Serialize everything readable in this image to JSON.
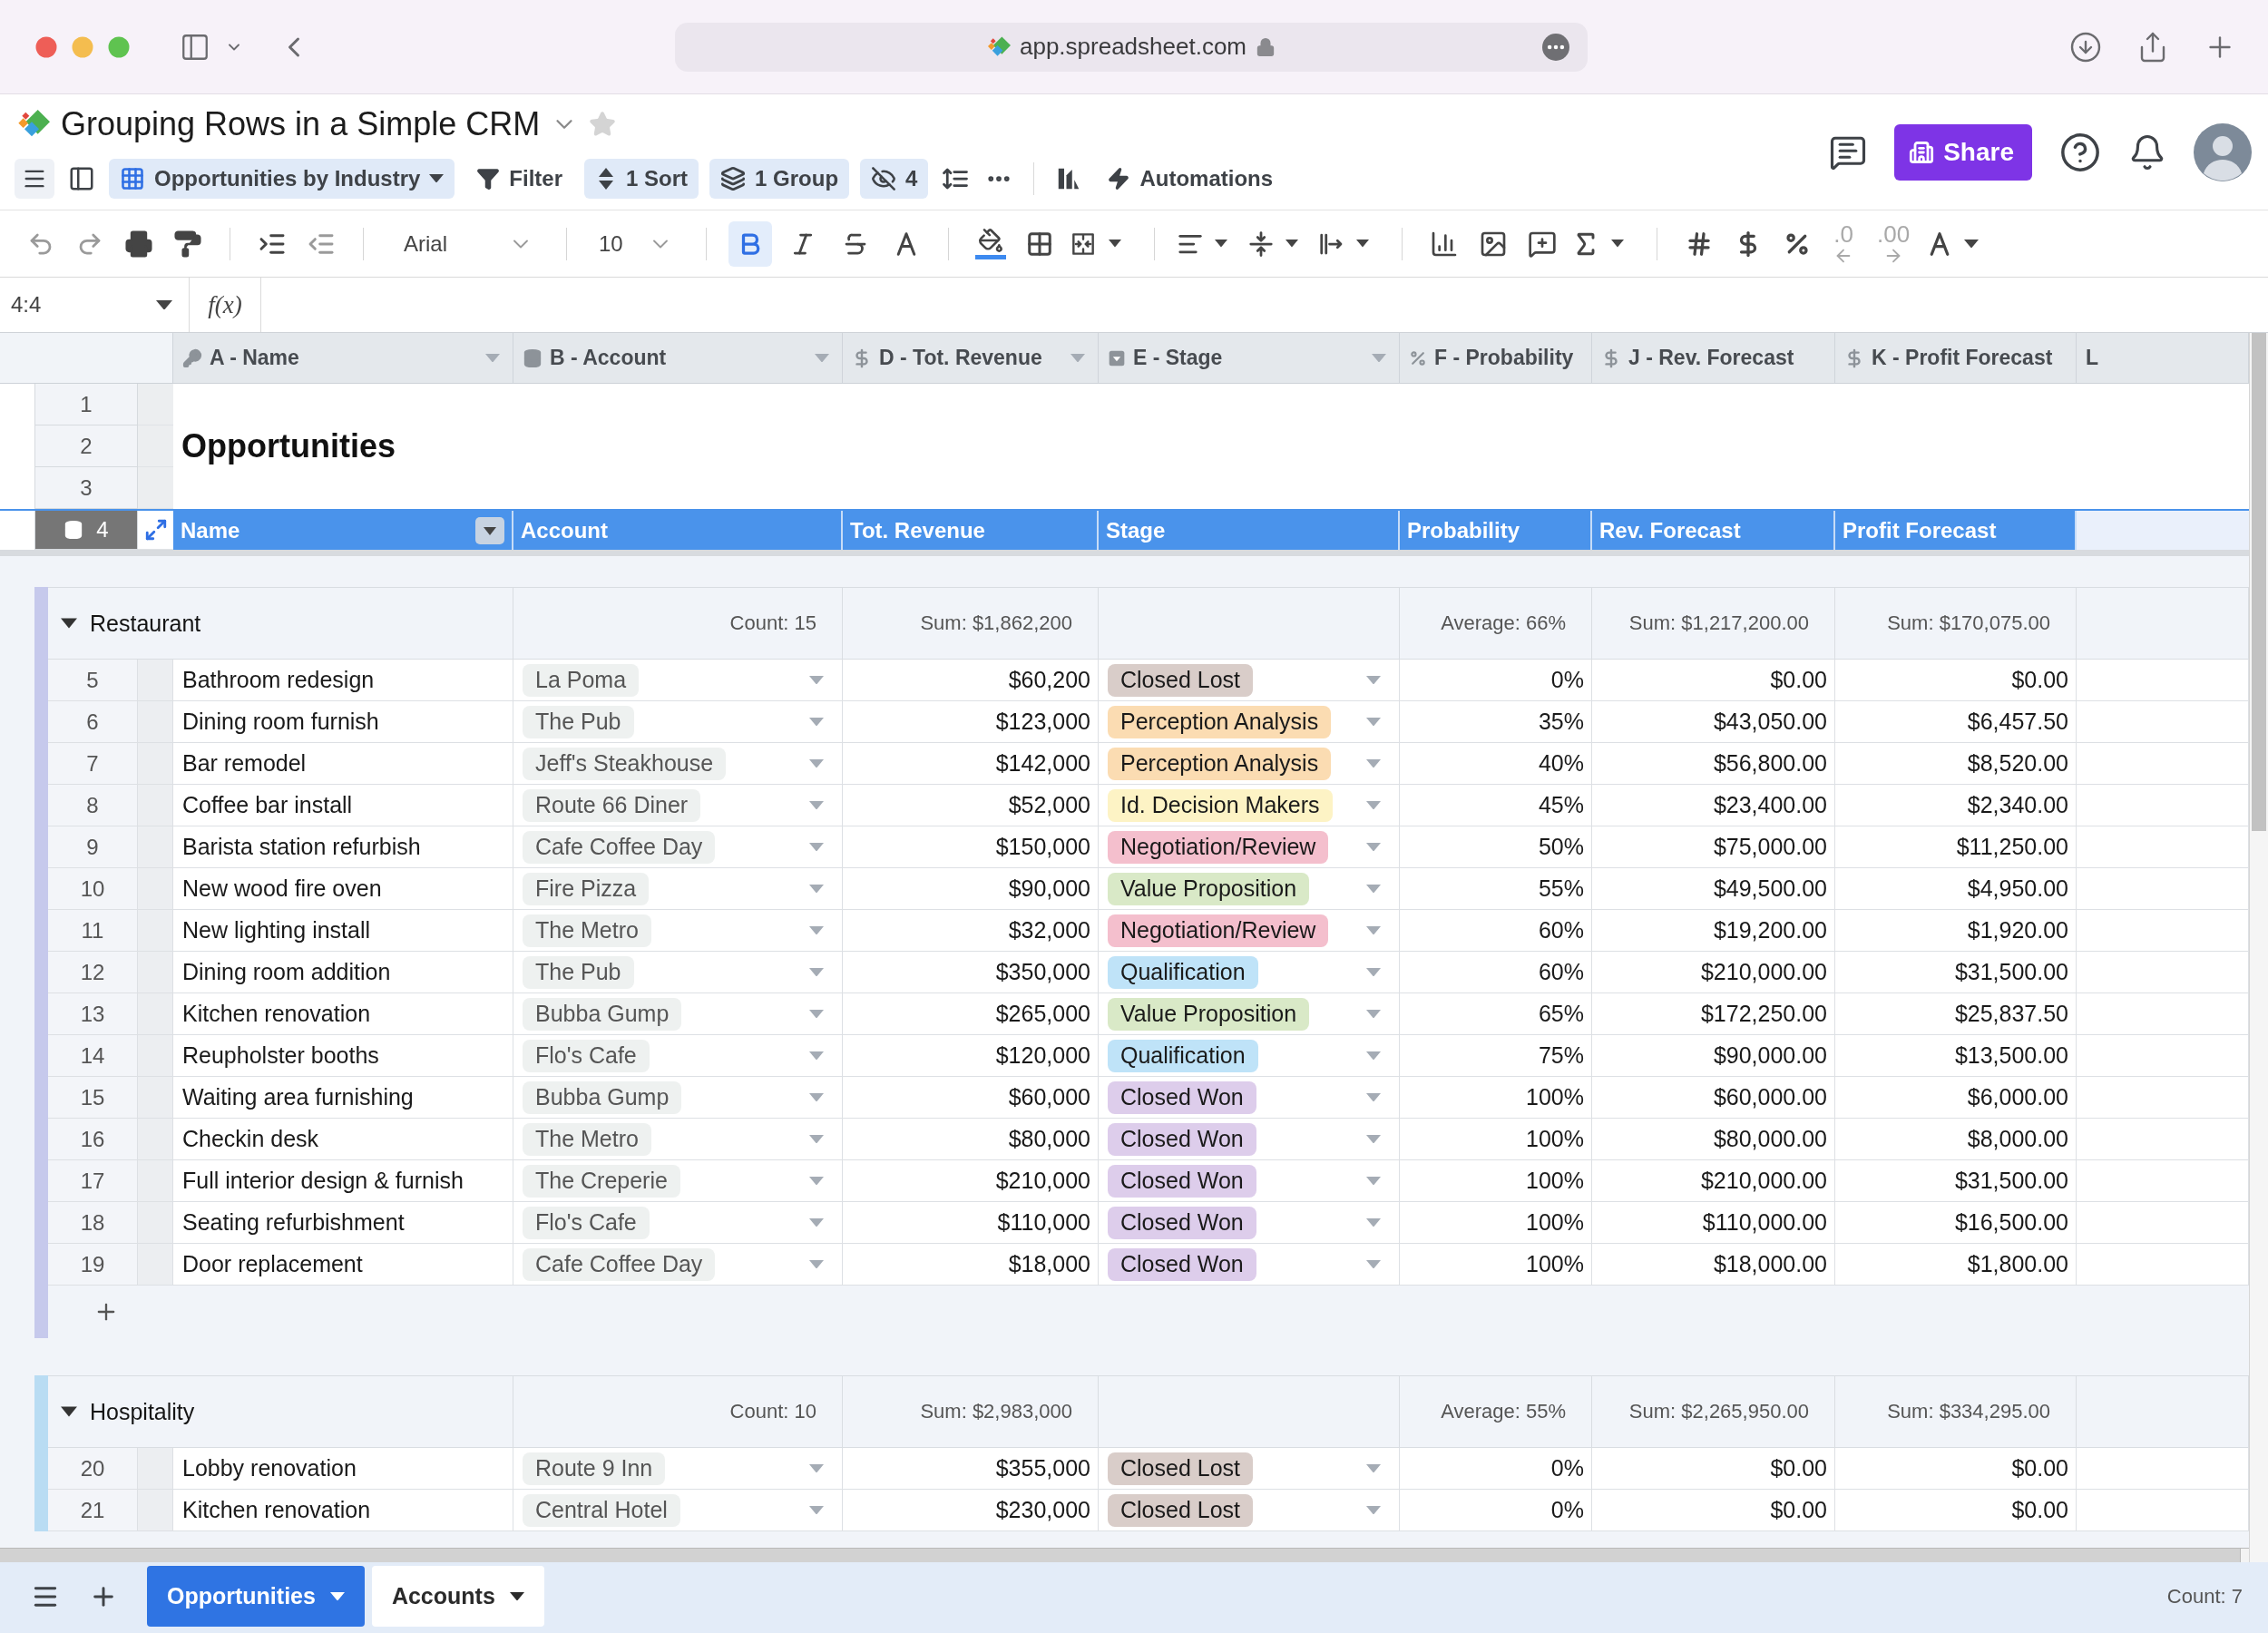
{
  "browser": {
    "url": "app.spreadsheet.com"
  },
  "app_header": {
    "title": "Grouping Rows in a Simple CRM",
    "starred": false,
    "share_label": "Share"
  },
  "view_toolbar": {
    "view": {
      "label": "Opportunities by Industry",
      "active": true
    },
    "tools": [
      {
        "kind": "filter",
        "label": "Filter",
        "active": false
      },
      {
        "kind": "sort",
        "label": "1 Sort",
        "active": true
      },
      {
        "kind": "group",
        "label": "1 Group",
        "active": true
      },
      {
        "kind": "hidden_fields",
        "label": "4",
        "active": true
      }
    ],
    "automations": {
      "label": "Automations"
    }
  },
  "format_toolbar": {
    "history": [
      {
        "kind": "undo",
        "disabled": true
      },
      {
        "kind": "redo",
        "disabled": true
      }
    ],
    "indent": [
      {
        "kind": "increase",
        "disabled": false
      },
      {
        "kind": "decrease",
        "disabled": true
      }
    ],
    "font": "Arial",
    "font_size": "10",
    "text_styles": [
      {
        "kind": "bold",
        "on": true
      },
      {
        "kind": "italic",
        "on": false
      },
      {
        "kind": "strikethrough",
        "on": false
      }
    ],
    "decimals": [
      {
        "kind": "decrease",
        "label": ".0",
        "disabled": true
      },
      {
        "kind": "increase",
        "label": ".00",
        "disabled": true
      }
    ]
  },
  "formula_bar": {
    "cell_ref": "4:4",
    "function_label": "f(x)"
  },
  "columns": [
    {
      "label": "A - Name",
      "kind": "key",
      "has_menu": true
    },
    {
      "label": "B - Account",
      "kind": "lookup",
      "has_menu": true
    },
    {
      "label": "D - Tot. Revenue",
      "kind": "currency",
      "has_menu": true
    },
    {
      "label": "E - Stage",
      "kind": "select",
      "has_menu": true
    },
    {
      "label": "F - Probability",
      "kind": "percent",
      "has_menu": false
    },
    {
      "label": "J - Rev. Forecast",
      "kind": "currency",
      "has_menu": false
    },
    {
      "label": "K - Profit Forecast",
      "kind": "currency",
      "has_menu": false
    },
    {
      "label": "L",
      "kind": "plain",
      "has_menu": false
    }
  ],
  "top_rows": [
    {
      "number": "1",
      "kind": "blank",
      "selected": false
    },
    {
      "number": "2",
      "kind": "title",
      "selected": false,
      "title": "Opportunities"
    },
    {
      "number": "3",
      "kind": "blank",
      "selected": false
    },
    {
      "number": "4",
      "kind": "header",
      "selected": true,
      "cells": [
        "Name",
        "Account",
        "Tot. Revenue",
        "Stage",
        "Probability",
        "Rev. Forecast",
        "Profit Forecast"
      ]
    }
  ],
  "groups": [
    {
      "name": "Restaurant",
      "expanded": true,
      "color": "#c6c9ec",
      "add_row": true,
      "summary": {
        "count": "Count: 15",
        "revenue": "Sum: $1,862,200",
        "probability": "Average: 66%",
        "rev_forecast": "Sum: $1,217,200.00",
        "profit_forecast": "Sum: $170,075.00"
      },
      "rows": [
        {
          "number": "5",
          "name": "Bathroom redesign",
          "account": "La Poma",
          "revenue": "$60,200",
          "stage": {
            "label": "Closed Lost",
            "color": "#d9cdc9"
          },
          "probability": "0%",
          "rev_forecast": "$0.00",
          "profit_forecast": "$0.00"
        },
        {
          "number": "6",
          "name": "Dining room furnish",
          "account": "The Pub",
          "revenue": "$123,000",
          "stage": {
            "label": "Perception Analysis",
            "color": "#fbdcb2"
          },
          "probability": "35%",
          "rev_forecast": "$43,050.00",
          "profit_forecast": "$6,457.50"
        },
        {
          "number": "7",
          "name": "Bar remodel",
          "account": "Jeff's Steakhouse",
          "revenue": "$142,000",
          "stage": {
            "label": "Perception Analysis",
            "color": "#fbdcb2"
          },
          "probability": "40%",
          "rev_forecast": "$56,800.00",
          "profit_forecast": "$8,520.00"
        },
        {
          "number": "8",
          "name": "Coffee bar install",
          "account": "Route 66 Diner",
          "revenue": "$52,000",
          "stage": {
            "label": "Id. Decision Makers",
            "color": "#fdf3c5"
          },
          "probability": "45%",
          "rev_forecast": "$23,400.00",
          "profit_forecast": "$2,340.00"
        },
        {
          "number": "9",
          "name": "Barista station refurbish",
          "account": "Cafe Coffee Day",
          "revenue": "$150,000",
          "stage": {
            "label": "Negotiation/Review",
            "color": "#f4bfcd"
          },
          "probability": "50%",
          "rev_forecast": "$75,000.00",
          "profit_forecast": "$11,250.00"
        },
        {
          "number": "10",
          "name": "New wood fire oven",
          "account": "Fire Pizza",
          "revenue": "$90,000",
          "stage": {
            "label": "Value Proposition",
            "color": "#d9e9c7"
          },
          "probability": "55%",
          "rev_forecast": "$49,500.00",
          "profit_forecast": "$4,950.00"
        },
        {
          "number": "11",
          "name": "New lighting install",
          "account": "The Metro",
          "revenue": "$32,000",
          "stage": {
            "label": "Negotiation/Review",
            "color": "#f4bfcd"
          },
          "probability": "60%",
          "rev_forecast": "$19,200.00",
          "profit_forecast": "$1,920.00"
        },
        {
          "number": "12",
          "name": "Dining room addition",
          "account": "The Pub",
          "revenue": "$350,000",
          "stage": {
            "label": "Qualification",
            "color": "#bfe3f8"
          },
          "probability": "60%",
          "rev_forecast": "$210,000.00",
          "profit_forecast": "$31,500.00"
        },
        {
          "number": "13",
          "name": "Kitchen renovation",
          "account": "Bubba Gump",
          "revenue": "$265,000",
          "stage": {
            "label": "Value Proposition",
            "color": "#d9e9c7"
          },
          "probability": "65%",
          "rev_forecast": "$172,250.00",
          "profit_forecast": "$25,837.50"
        },
        {
          "number": "14",
          "name": "Reupholster booths",
          "account": "Flo's Cafe",
          "revenue": "$120,000",
          "stage": {
            "label": "Qualification",
            "color": "#bfe3f8"
          },
          "probability": "75%",
          "rev_forecast": "$90,000.00",
          "profit_forecast": "$13,500.00"
        },
        {
          "number": "15",
          "name": "Waiting area furnishing",
          "account": "Bubba Gump",
          "revenue": "$60,000",
          "stage": {
            "label": "Closed Won",
            "color": "#ddcdeb"
          },
          "probability": "100%",
          "rev_forecast": "$60,000.00",
          "profit_forecast": "$6,000.00"
        },
        {
          "number": "16",
          "name": "Checkin desk",
          "account": "The Metro",
          "revenue": "$80,000",
          "stage": {
            "label": "Closed Won",
            "color": "#ddcdeb"
          },
          "probability": "100%",
          "rev_forecast": "$80,000.00",
          "profit_forecast": "$8,000.00"
        },
        {
          "number": "17",
          "name": "Full interior design & furnish",
          "account": "The Creperie",
          "revenue": "$210,000",
          "stage": {
            "label": "Closed Won",
            "color": "#ddcdeb"
          },
          "probability": "100%",
          "rev_forecast": "$210,000.00",
          "profit_forecast": "$31,500.00"
        },
        {
          "number": "18",
          "name": "Seating refurbishment",
          "account": "Flo's Cafe",
          "revenue": "$110,000",
          "stage": {
            "label": "Closed Won",
            "color": "#ddcdeb"
          },
          "probability": "100%",
          "rev_forecast": "$110,000.00",
          "profit_forecast": "$16,500.00"
        },
        {
          "number": "19",
          "name": "Door replacement",
          "account": "Cafe Coffee Day",
          "revenue": "$18,000",
          "stage": {
            "label": "Closed Won",
            "color": "#ddcdeb"
          },
          "probability": "100%",
          "rev_forecast": "$18,000.00",
          "profit_forecast": "$1,800.00"
        }
      ]
    },
    {
      "name": "Hospitality",
      "expanded": true,
      "color": "#b9dcf3",
      "add_row": false,
      "summary": {
        "count": "Count: 10",
        "revenue": "Sum: $2,983,000",
        "probability": "Average: 55%",
        "rev_forecast": "Sum: $2,265,950.00",
        "profit_forecast": "Sum: $334,295.00"
      },
      "rows": [
        {
          "number": "20",
          "name": "Lobby renovation",
          "account": "Route 9 Inn",
          "revenue": "$355,000",
          "stage": {
            "label": "Closed Lost",
            "color": "#d9cdc9"
          },
          "probability": "0%",
          "rev_forecast": "$0.00",
          "profit_forecast": "$0.00"
        },
        {
          "number": "21",
          "name": "Kitchen renovation",
          "account": "Central Hotel",
          "revenue": "$230,000",
          "stage": {
            "label": "Closed Lost",
            "color": "#d9cdc9"
          },
          "probability": "0%",
          "rev_forecast": "$0.00",
          "profit_forecast": "$0.00"
        }
      ]
    }
  ],
  "sheet_tabs": [
    {
      "label": "Opportunities",
      "selected": true
    },
    {
      "label": "Accounts",
      "selected": false
    }
  ],
  "status_bar": {
    "summary": "Count: 7"
  }
}
